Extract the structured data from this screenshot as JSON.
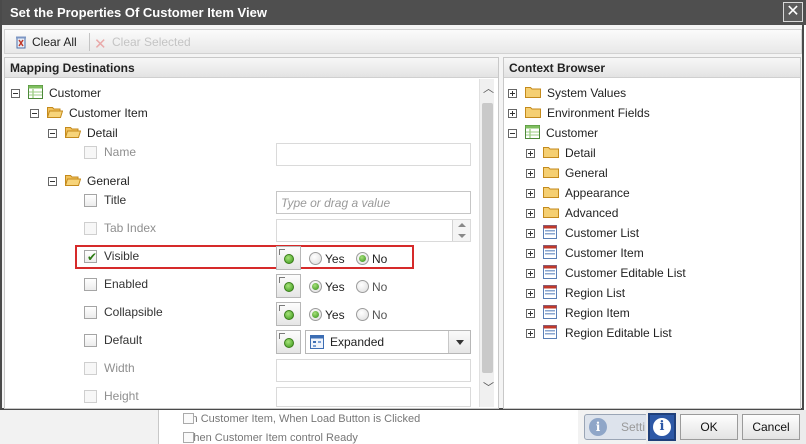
{
  "dialog": {
    "title": "Set the Properties Of Customer Item View",
    "close_glyph": "✕"
  },
  "toolbar": {
    "clear_all": "Clear All",
    "clear_selected": "Clear Selected"
  },
  "mapping": {
    "header": "Mapping Destinations",
    "root": "Customer",
    "item": "Customer Item",
    "detail_group": "Detail",
    "general_group": "General",
    "name_label": "Name",
    "title_label": "Title",
    "title_placeholder": "Type or drag a value",
    "tab_index_label": "Tab Index",
    "visible_label": "Visible",
    "enabled_label": "Enabled",
    "collapsible_label": "Collapsible",
    "default_label": "Default",
    "default_value": "Expanded",
    "width_label": "Width",
    "height_label": "Height",
    "yes": "Yes",
    "no": "No",
    "visible_selected": "No",
    "enabled_selected": "Yes",
    "collapsible_selected": "Yes",
    "visible_checked": true
  },
  "context": {
    "header": "Context Browser",
    "items": [
      "System Values",
      "Environment Fields",
      "Customer",
      "Detail",
      "General",
      "Appearance",
      "Advanced",
      "Customer List",
      "Customer Item",
      "Customer Editable List",
      "Region List",
      "Region Item",
      "Region Editable List"
    ]
  },
  "footer": {
    "ok": "OK",
    "cancel": "Cancel",
    "help_glyph": "i",
    "bg_settings": "Setti",
    "bg_row1": "On Customer Item, When Load Button is Clicked",
    "bg_row2": "When Customer Item control Ready"
  }
}
